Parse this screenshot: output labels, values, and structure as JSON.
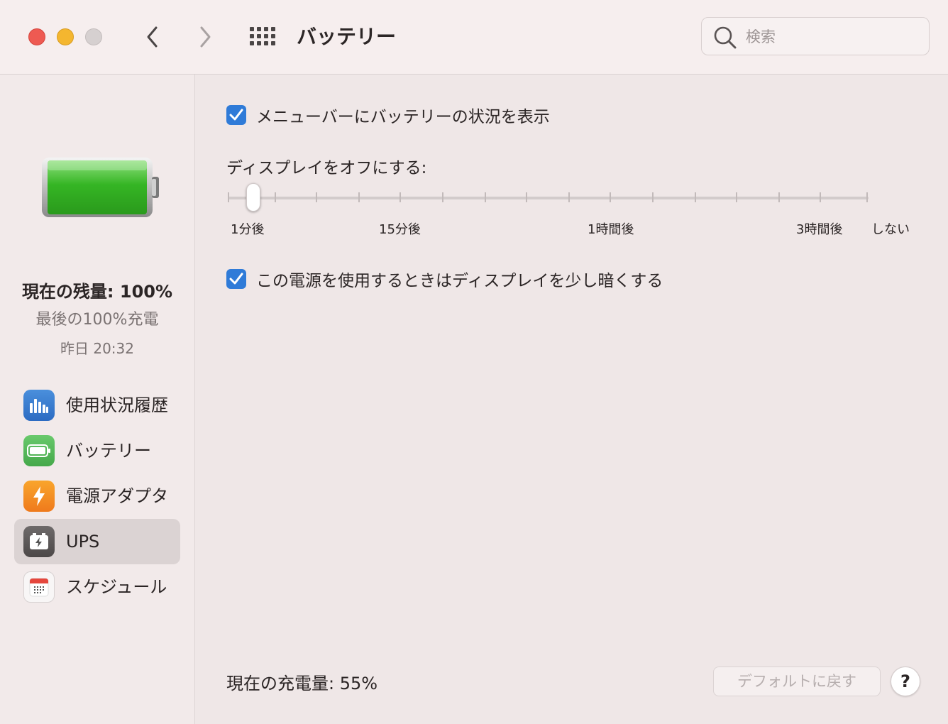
{
  "window": {
    "title": "バッテリー",
    "search_placeholder": "検索"
  },
  "sidebar": {
    "status": {
      "current_level": "現在の残量: 100%",
      "last_charge": "最後の100%充電",
      "last_charge_time": "昨日 20:32"
    },
    "items": [
      {
        "label": "使用状況履歴",
        "icon": "usage-history-icon",
        "selected": false
      },
      {
        "label": "バッテリー",
        "icon": "battery-icon",
        "selected": false
      },
      {
        "label": "電源アダプタ",
        "icon": "power-adapter-icon",
        "selected": false
      },
      {
        "label": "UPS",
        "icon": "ups-icon",
        "selected": true
      },
      {
        "label": "スケジュール",
        "icon": "schedule-icon",
        "selected": false
      }
    ]
  },
  "main": {
    "menubar_checkbox": {
      "label": "メニューバーにバッテリーの状況を表示",
      "checked": true
    },
    "display_off": {
      "label": "ディスプレイをオフにする:",
      "tick_labels": [
        "1分後",
        "15分後",
        "1時間後",
        "3時間後",
        "しない"
      ],
      "selected_label": "1分後"
    },
    "dim_checkbox": {
      "label": "この電源を使用するときはディスプレイを少し暗くする",
      "checked": true
    },
    "current_charge": "現在の充電量: 55%",
    "restore_defaults_label": "デフォルトに戻す",
    "help_label": "?"
  },
  "colors": {
    "accent": "#2f7bd8",
    "window_bg": "#efe7e7",
    "close": "#ee5a52",
    "minimize": "#f4b62f",
    "battery_fill": "#3dbb2e"
  }
}
